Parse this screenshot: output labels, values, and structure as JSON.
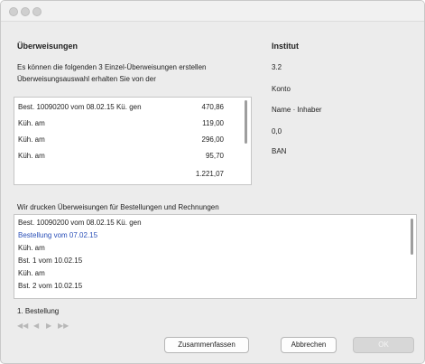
{
  "window": {
    "title": ""
  },
  "heading": "Überweisungen",
  "intro_line1": "Es können die folgenden 3 Einzel-Überweisungen erstellen",
  "intro_line2": "Überweisungsauswahl erhalten Sie von der",
  "transfers": [
    {
      "desc": "Best. 10090200 vom 08.02.15 Kü. gen",
      "amount": "470,86"
    },
    {
      "desc": "Küh. am",
      "amount": "119,00"
    },
    {
      "desc": "Küh. am",
      "amount": "296,00"
    },
    {
      "desc": "Küh. am",
      "amount": "95,70"
    }
  ],
  "total": "1.221,07",
  "details": {
    "heading": "Institut",
    "line1": "3.2",
    "line2": "Konto",
    "line3": "Name · Inhaber",
    "line4": "0,0",
    "line5": "BAN"
  },
  "status_line": "Wir drucken Überweisungen für Bestellungen und Rechnungen",
  "log": [
    {
      "text": "Best. 10090200 vom 08.02.15 Kü. gen",
      "style": "normal"
    },
    {
      "text": "Bestellung vom 07.02.15",
      "style": "link"
    },
    {
      "text": "Küh. am",
      "style": "normal"
    },
    {
      "text": "Bst. 1 vom 10.02.15",
      "style": "normal"
    },
    {
      "text": "Küh. am",
      "style": "normal"
    },
    {
      "text": "Bst. 2 vom 10.02.15",
      "style": "normal"
    }
  ],
  "footer_note": "1. Bestellung",
  "nav": {
    "first": "◀◀",
    "prev": "◀",
    "next": "▶",
    "last": "▶▶"
  },
  "buttons": {
    "summarize": "Zusammenfassen",
    "cancel": "Abbrechen",
    "ok": "OK"
  },
  "colors": {
    "link": "#2a4fb8",
    "window_bg": "#ececec"
  }
}
